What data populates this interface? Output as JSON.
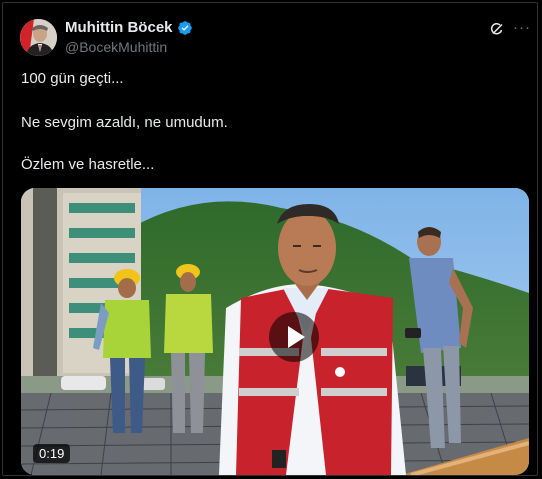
{
  "author": {
    "name": "Muhittin Böcek",
    "handle": "@BocekMuhittin",
    "verified": true
  },
  "tweet": {
    "line1": "100 gün geçti...",
    "line2": "Ne sevgim azaldı, ne umudum.",
    "line3": "Özlem ve hasretle..."
  },
  "video": {
    "duration": "0:19"
  },
  "icons": {
    "verified": "verified-badge-icon",
    "grok": "grok-icon",
    "more": "more-options-icon",
    "play": "play-icon"
  },
  "colors": {
    "background": "#000000",
    "text": "#e7e9ea",
    "muted": "#71767b",
    "verified": "#1d9bf0"
  }
}
